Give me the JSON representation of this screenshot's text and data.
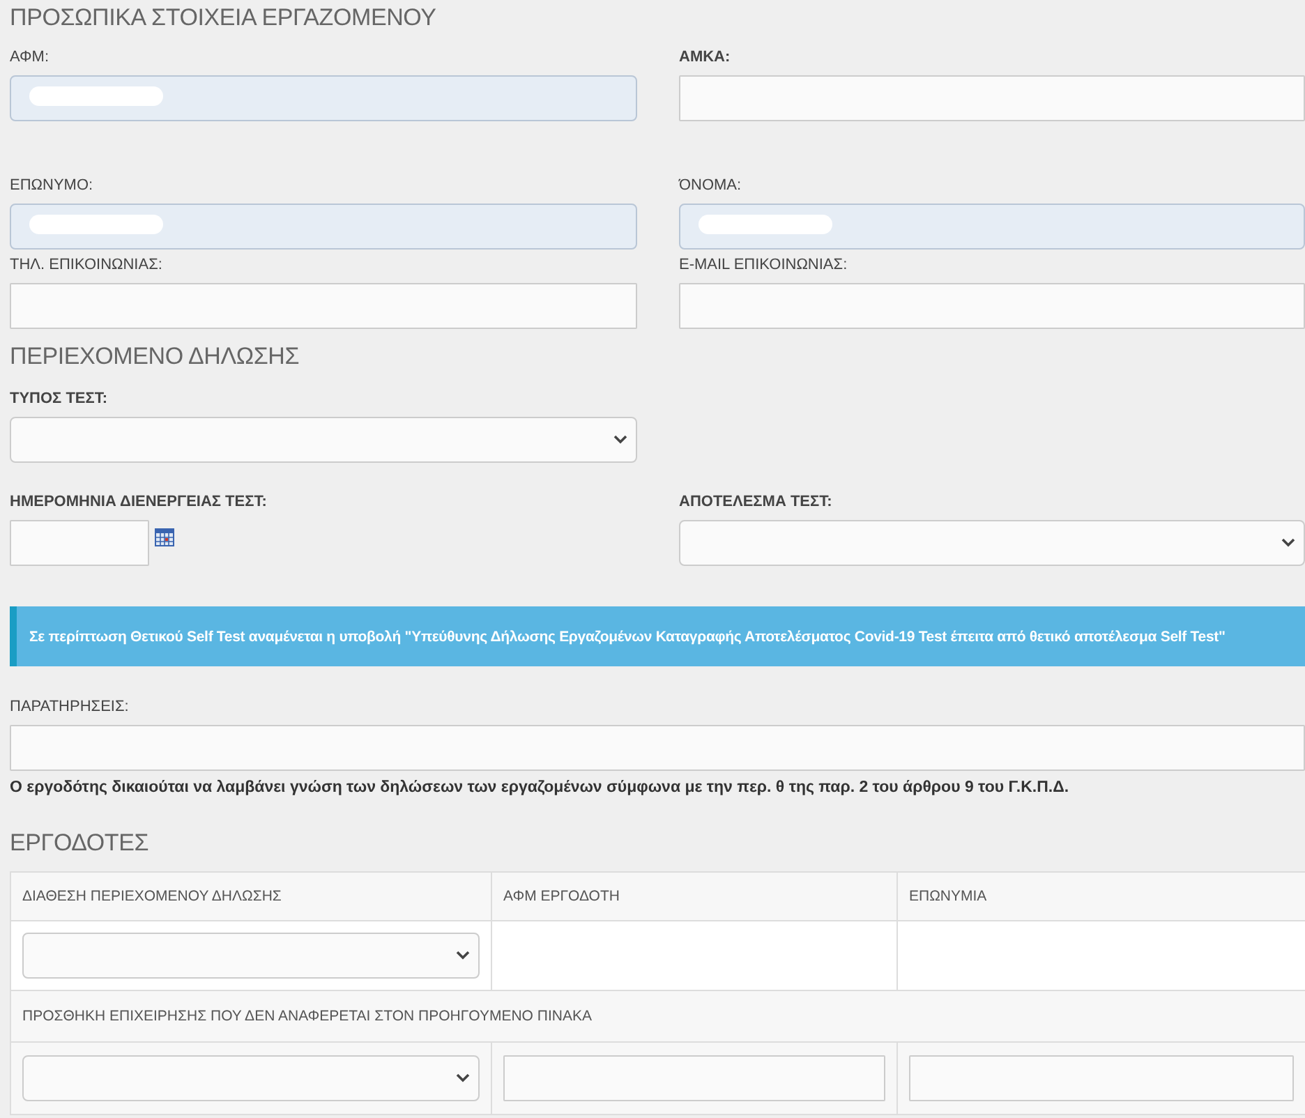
{
  "sections": [
    {
      "title": "ΠΡΟΣΩΠΙΚΑ ΣΤΟΙΧΕΙΑ ΕΡΓΑΖΟΜΕΝΟΥ",
      "rows": [
        [
          {
            "label": "ΑΦΜ:",
            "bold": false,
            "kind": "text",
            "readonly": true,
            "redacted": true
          },
          {
            "label": "ΑΜΚΑ:",
            "bold": true,
            "kind": "text",
            "readonly": false,
            "redacted": false
          }
        ],
        [
          {
            "label": "ΕΠΩΝΥΜΟ:",
            "bold": false,
            "kind": "text",
            "readonly": true,
            "redacted": true
          },
          {
            "label": "ΌΝΟΜΑ:",
            "bold": false,
            "kind": "text",
            "readonly": true,
            "redacted": true
          }
        ],
        [
          {
            "label": "ΤΗΛ. ΕΠΙΚΟΙΝΩΝΙΑΣ:",
            "bold": false,
            "kind": "text",
            "readonly": false,
            "redacted": false
          },
          {
            "label": "E-MAIL ΕΠΙΚΟΙΝΩΝΙΑΣ:",
            "bold": false,
            "kind": "text",
            "readonly": false,
            "redacted": false
          }
        ]
      ]
    },
    {
      "title": "ΠΕΡΙΕΧΟΜΕΝΟ ΔΗΛΩΣΗΣ",
      "rows": [
        [
          {
            "label": "ΤΥΠΟΣ ΤΕΣΤ:",
            "bold": true,
            "kind": "select"
          }
        ],
        [
          {
            "label": "ΗΜΕΡΟΜΗΝΙΑ ΔΙΕΝΕΡΓΕΙΑΣ ΤΕΣΤ:",
            "bold": true,
            "kind": "date"
          },
          {
            "label": "ΑΠΟΤΕΛΕΣΜΑ ΤΕΣΤ:",
            "bold": true,
            "kind": "select"
          }
        ]
      ]
    }
  ],
  "alert": "Σε περίπτωση Θετικού Self Test αναμένεται η υποβολή \"Υπεύθυνης Δήλωσης Εργαζομένων Καταγραφής Αποτελέσματος Covid-19 Test έπειτα από θετικό αποτέλεσμα Self Test\"",
  "remarks": {
    "label": "ΠΑΡΑΤΗΡΗΣΕΙΣ:",
    "bold": false,
    "kind": "text",
    "readonly": false,
    "redacted": false
  },
  "notice": "Ο εργοδότης δικαιούται να λαμβάνει γνώση των δηλώσεων των εργαζομένων σύμφωνα με την περ. θ της παρ. 2 του άρθρου 9 του Γ.Κ.Π.Δ.",
  "employers": {
    "title": "ΕΡΓΟΔΟΤΕΣ",
    "columns": [
      "ΔΙΑΘΕΣΗ ΠΕΡΙΕΧΟΜΕΝΟΥ ΔΗΛΩΣΗΣ",
      "ΑΦΜ ΕΡΓΟΔΟΤΗ",
      "ΕΠΩΝΥΜΙΑ"
    ],
    "rows": [
      [
        {
          "kind": "select"
        },
        {
          "kind": "empty"
        },
        {
          "kind": "empty"
        }
      ]
    ],
    "add_title": "ΠΡΟΣΘΗΚΗ ΕΠΙΧΕΙΡΗΣΗΣ ΠΟΥ ΔΕΝ ΑΝΑΦΕΡΕΤΑΙ ΣΤΟΝ ΠΡΟΗΓΟΥΜΕΝΟ ΠΙΝΑΚΑ",
    "add_row": [
      {
        "kind": "select"
      },
      {
        "kind": "text"
      },
      {
        "kind": "text"
      }
    ]
  }
}
